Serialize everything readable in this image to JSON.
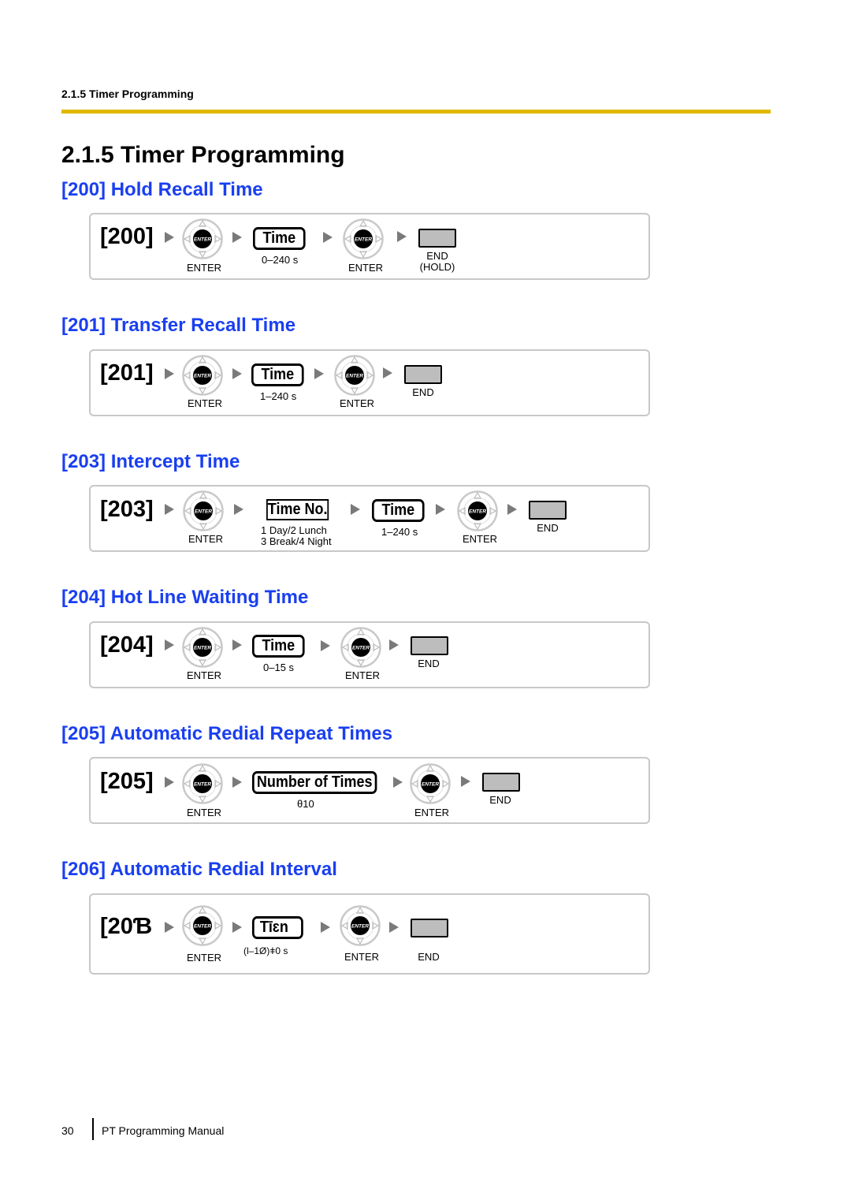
{
  "header": {
    "running_head": "2.1.5 Timer Programming",
    "rule_color": "#e0b800"
  },
  "page_title": "2.1.5  Timer Programming",
  "accent_color": "#1a3ff0",
  "icons": {
    "enter": "enter-navigator-key-icon",
    "arrow": "triangle-right-icon",
    "end": "end-key-icon"
  },
  "sections": [
    {
      "title": "[200] Hold Recall Time",
      "code": "[200]",
      "enter_label": "ENTER",
      "input_label": "Time",
      "range": "0–240 s",
      "enter2_label": "ENTER",
      "end_label": "END",
      "end_sub": "(HOLD)"
    },
    {
      "title": "[201] Transfer Recall Time",
      "code": "[201]",
      "enter_label": "ENTER",
      "input_label": "Time",
      "range": "1–240 s",
      "enter2_label": "ENTER",
      "end_label": "END"
    },
    {
      "title": "[203] Intercept Time",
      "code": "[203]",
      "enter_label": "ENTER",
      "input1_label": "Time No.",
      "input1_options": [
        "1 Day/2 Lunch",
        "3 Break/4 Night"
      ],
      "input_label": "Time",
      "range": "1–240 s",
      "enter2_label": "ENTER",
      "end_label": "END"
    },
    {
      "title": "[204] Hot Line Waiting Time",
      "code": "[204]",
      "enter_label": "ENTER",
      "input_label": "Time",
      "range": "0–15 s",
      "enter2_label": "ENTER",
      "end_label": "END"
    },
    {
      "title": "[205] Automatic Redial Repeat Times",
      "code": "[205]",
      "enter_label": "ENTER",
      "input_label": "Number of Times",
      "range": "θ10",
      "enter2_label": "ENTER",
      "end_label": "END"
    },
    {
      "title": "[206] Automatic Redial Interval",
      "code": "[20Ɓ",
      "enter_label": "ENTER",
      "input_label": "Tīɛn",
      "range": "(l–1Ø)ǂ0 s",
      "enter2_label": "ENTER",
      "end_label": "END"
    }
  ],
  "footer": {
    "page_number": "30",
    "manual_title": "PT Programming Manual"
  }
}
